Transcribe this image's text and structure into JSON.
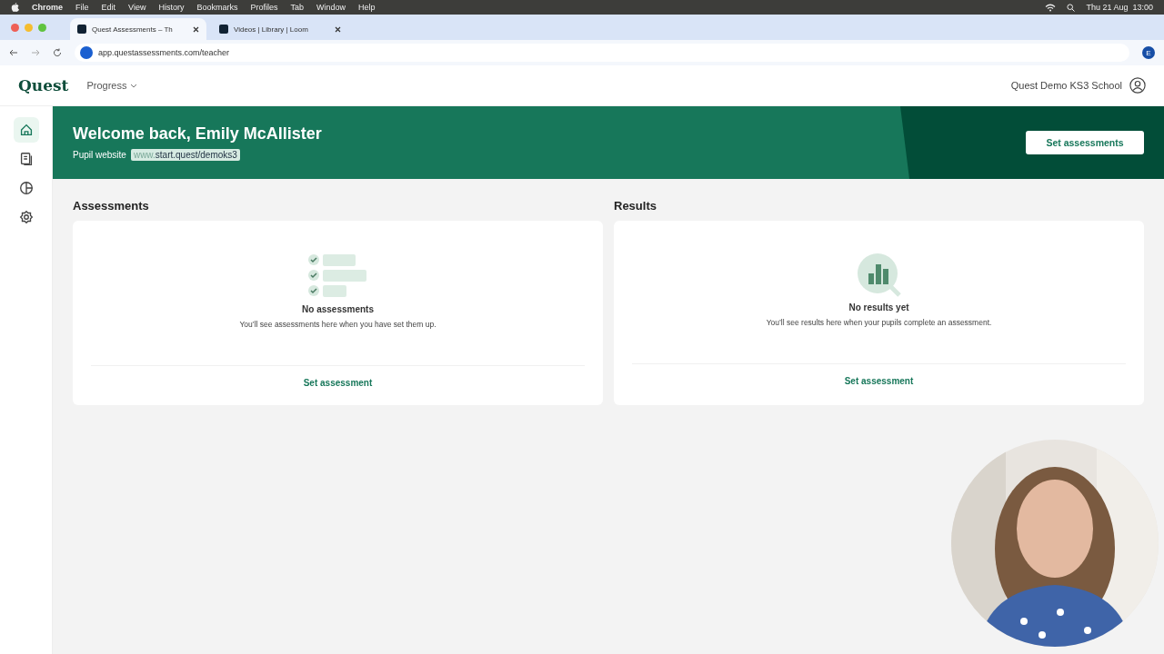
{
  "menu_bar": {
    "app": "Chrome",
    "menus": [
      "File",
      "Edit",
      "View",
      "History",
      "Bookmarks",
      "Profiles",
      "Tab",
      "Window",
      "Help"
    ],
    "clock": "Thu 21 Aug  13:00"
  },
  "browser": {
    "tabs": [
      {
        "title": "Quest Assessments – Th",
        "selected": true
      },
      {
        "title": "Videos | Library | Loom",
        "selected": false
      }
    ],
    "url": "app.questassessments.com/teacher",
    "profile_initial": "E"
  },
  "app": {
    "logo": "Quest",
    "nav": "Progress",
    "school": "Quest Demo KS3 School"
  },
  "sidebar": [
    {
      "kind": "home",
      "selected": true
    },
    {
      "kind": "library",
      "selected": false
    },
    {
      "kind": "chart",
      "selected": false
    },
    {
      "kind": "settings",
      "selected": false
    }
  ],
  "banner": {
    "title": "Welcome back, Emily McAllister",
    "pupil_label": "Pupil website",
    "url_prefix": "www.",
    "url": "start.quest/demoks3",
    "button": "Set assessments"
  },
  "panels": [
    {
      "kind": "assessments",
      "heading": "Assessments",
      "empty_title": "No assessments",
      "empty_text": "You’ll see assessments here when you have set them up.",
      "action": "Set assessment"
    },
    {
      "kind": "results",
      "heading": "Results",
      "empty_title": "No results yet",
      "empty_text": "You’ll see results here when your pupils complete an assessment.",
      "action": "Set assessment"
    }
  ]
}
